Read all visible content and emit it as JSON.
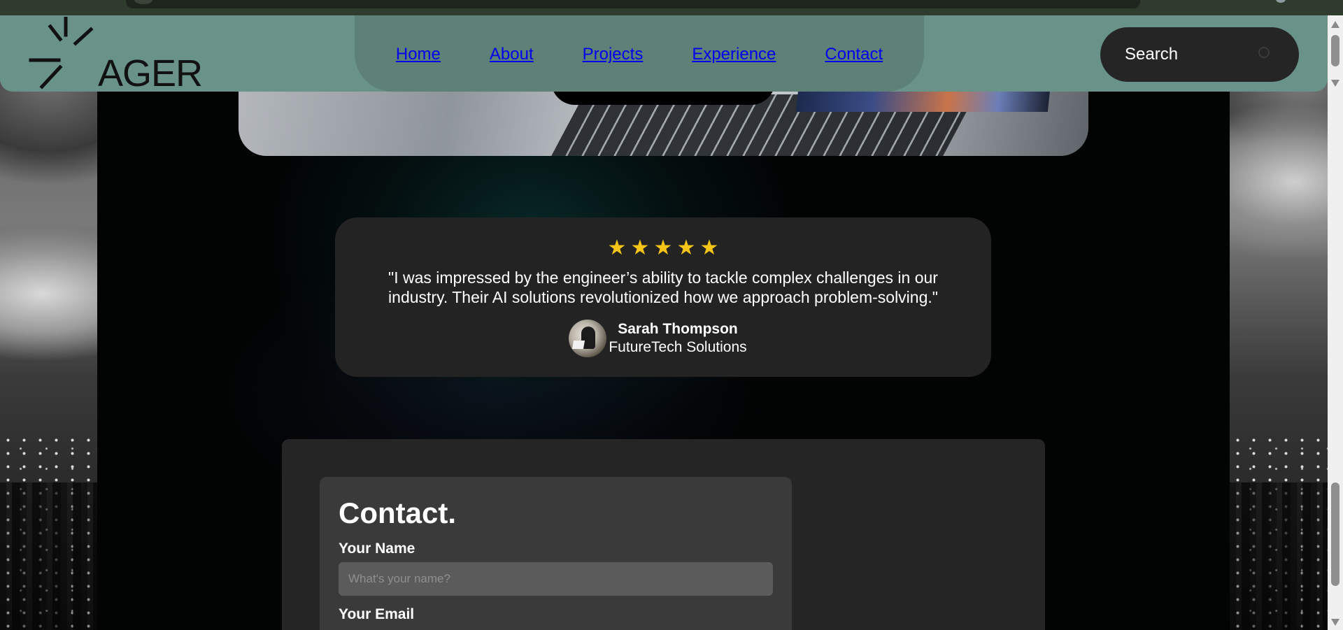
{
  "header": {
    "logo_text": "AGER",
    "nav": [
      {
        "label": "Home"
      },
      {
        "label": "About"
      },
      {
        "label": "Projects"
      },
      {
        "label": "Experience"
      },
      {
        "label": "Contact"
      }
    ],
    "search_placeholder": "Search"
  },
  "testimonial": {
    "rating": 5,
    "star_glyph": "★",
    "star_color": "#f5c518",
    "quote_line1": "\"I was impressed by the engineer’s ability to tackle complex challenges in our",
    "quote_line2": "industry. Their AI solutions revolutionized how we approach problem-solving.\"",
    "author_name": "Sarah Thompson",
    "author_company": "FutureTech Solutions"
  },
  "contact": {
    "title": "Contact.",
    "name_label": "Your Name",
    "name_placeholder": "What's your name?",
    "email_label": "Your Email"
  },
  "colors": {
    "header_bg": "#699388",
    "nav_pill_bg": "#5d8177",
    "card_bg": "#232323",
    "link": "#0000ee"
  }
}
